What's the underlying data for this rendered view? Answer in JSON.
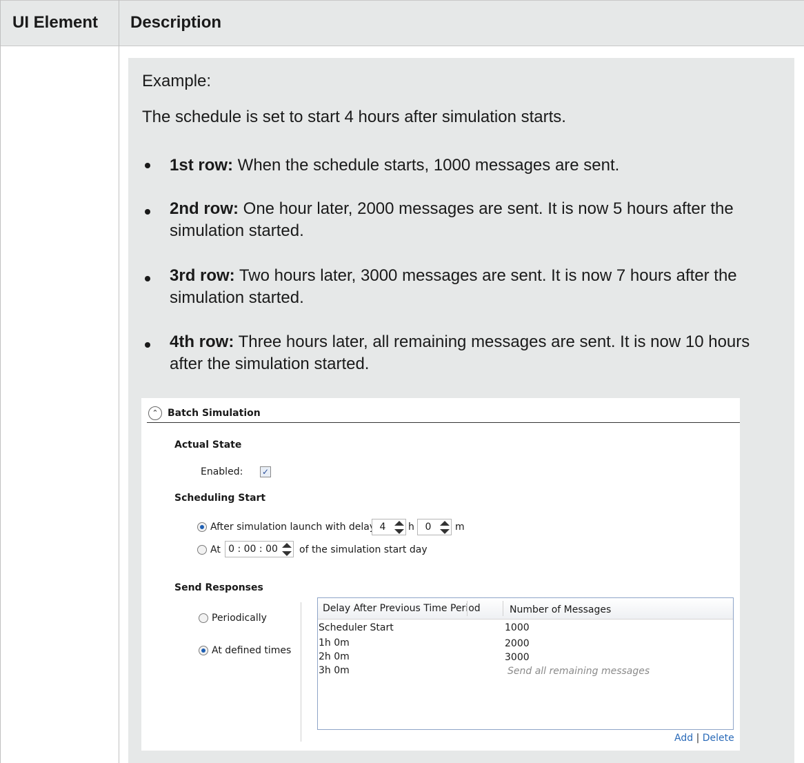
{
  "table": {
    "col_ui_element": "UI Element",
    "col_description": "Description"
  },
  "description": {
    "example_label": "Example:",
    "intro": "The schedule is set to start 4 hours after simulation starts.",
    "bullets": [
      {
        "label": "1st row:",
        "text": " When the schedule starts, 1000 messages are sent."
      },
      {
        "label": "2nd row:",
        "text": " One hour later, 2000 messages are sent. It is now 5 hours after the simulation started."
      },
      {
        "label": "3rd row:",
        "text": " Two hours later, 3000 messages are sent. It is now 7 hours after the simulation started."
      },
      {
        "label": "4th row:",
        "text": " Three hours later, all remaining messages are sent. It is now 10 hours after the simulation started."
      }
    ]
  },
  "panel": {
    "title": "Batch Simulation",
    "actual_state": {
      "heading": "Actual State",
      "enabled_label": "Enabled:",
      "enabled_checked": true,
      "check_glyph": "✓"
    },
    "scheduling_start": {
      "heading": "Scheduling Start",
      "option_delay_label": "After simulation launch with delay",
      "delay_hours": "4",
      "hours_unit": "h",
      "delay_minutes": "0",
      "minutes_unit": "m",
      "option_at_label": "At",
      "at_time": "0 : 00 : 00",
      "at_suffix": "of the simulation start day",
      "selected": "delay"
    },
    "send_responses": {
      "heading": "Send Responses",
      "option_periodically": "Periodically",
      "option_defined": "At defined times",
      "selected": "defined",
      "grid": {
        "columns": [
          "Delay After Previous Time Period",
          "Number of Messages"
        ],
        "rows": [
          {
            "delay": "Scheduler Start",
            "messages": "1000"
          },
          {
            "delay": "1h 0m",
            "messages": "2000"
          },
          {
            "delay": "2h 0m",
            "messages": "3000"
          },
          {
            "delay": "3h 0m",
            "messages": "Send all remaining messages"
          }
        ]
      },
      "add_link": "Add",
      "separator": "|",
      "delete_link": "Delete"
    }
  },
  "colors": {
    "header_bg": "#e6e8e8",
    "link": "#2a6ab8",
    "radio_selected": "#1d5fb3"
  }
}
